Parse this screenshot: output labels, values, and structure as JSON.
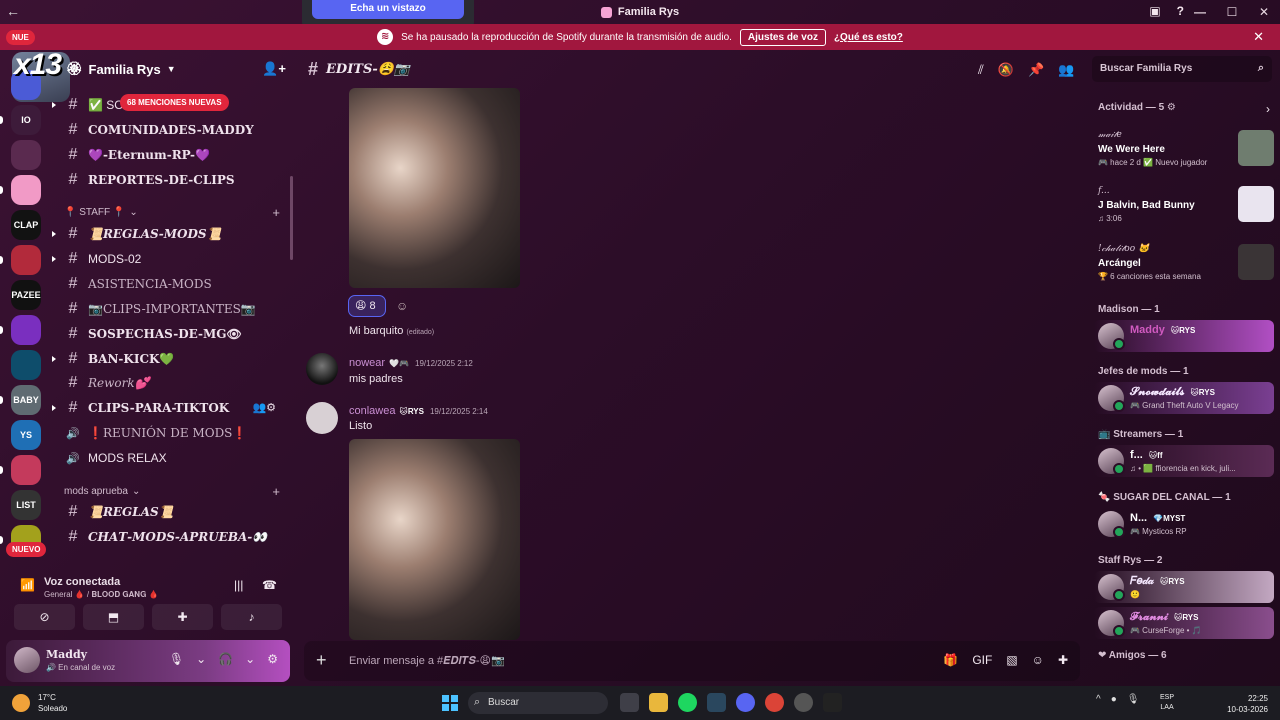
{
  "window": {
    "title": "Familia Rys",
    "peek_button": "Echa un vistazo"
  },
  "notice": {
    "text": "Se ha pausado la reproducción de Spotify durante la transmisión de audio.",
    "button": "Ajustes de voz",
    "link": "¿Qué es esto?"
  },
  "rail": {
    "top_badge": "NUE",
    "overlay_text": "x13",
    "io_label": "IO",
    "servers": [
      {
        "label": "",
        "badge": "",
        "color": "#4b5bd6"
      },
      {
        "label": "IO",
        "badge": "",
        "color": "#3d1b3a"
      },
      {
        "label": "",
        "badge": "",
        "color": "#5a2a4f"
      },
      {
        "label": "",
        "badge": "68",
        "color": "#f19ac6"
      },
      {
        "label": "CLAP",
        "badge": "43",
        "color": "#121212"
      },
      {
        "label": "",
        "badge": "10",
        "color": "#b22a3b"
      },
      {
        "label": "PAZEE",
        "badge": "2",
        "color": "#111"
      },
      {
        "label": "",
        "badge": "",
        "color": "#7a2fbf"
      },
      {
        "label": "",
        "badge": "6",
        "color": "#0e4d6b"
      },
      {
        "label": "BABY",
        "badge": "",
        "color": "#5f6b72"
      },
      {
        "label": "YS",
        "badge": "",
        "color": "#1f6fb5"
      },
      {
        "label": "",
        "badge": "77",
        "color": "#c43a5c"
      },
      {
        "label": "LIST",
        "badge": "5",
        "color": "#333"
      },
      {
        "label": "",
        "badge": "",
        "color": "#a3a11c"
      }
    ],
    "nuevo": "NUEVO"
  },
  "server": {
    "name": "Familia Rys",
    "mentions_pill": "68 MENCIONES NUEVAS"
  },
  "channels": [
    {
      "label": "✅ SOL",
      "style": "bold",
      "bullet": true
    },
    {
      "label": "COMUNIDADES-MADDY",
      "style": "serif"
    },
    {
      "label": "💜-Eternum-RP-💜",
      "style": "serif"
    },
    {
      "label": "REPORTES-DE-CLIPS",
      "style": "serif"
    }
  ],
  "categories": {
    "staff": "📍 STAFF 📍",
    "mods": "mods aprueba"
  },
  "staff_channels": [
    {
      "label": "📜𝑹𝑬𝑮𝑳𝑨𝑺-𝑴𝑶𝑫𝑺📜",
      "style": "serif italic",
      "bullet": true
    },
    {
      "label": "MODS-02",
      "style": "plain",
      "bullet": true
    },
    {
      "label": "ASISTENCIA-MODS",
      "style": "serif dim"
    },
    {
      "label": "📷CLIPS-IMPORTANTES📷",
      "style": "serif dim"
    },
    {
      "label": "SOSPECHAS-DE-MG👁",
      "style": "serif"
    },
    {
      "label": "BAN-KICK💚",
      "style": "serif",
      "bullet": true
    },
    {
      "label": "𝑅𝑒𝑤𝑜𝑟𝑘💕",
      "style": "serif italic dim"
    },
    {
      "label": "CLIPS-PARA-TIKTOK",
      "style": "serif",
      "bullet": true,
      "icons": "👥⚙"
    },
    {
      "label": "❗REUNIÓN DE MODS❗",
      "style": "serif dim",
      "voice": true
    },
    {
      "label": "MODS RELAX",
      "style": "plain",
      "voice": true
    }
  ],
  "mods_channels": [
    {
      "label": "📜𝑹𝑬𝑮𝑳𝑨𝑺📜",
      "style": "serif italic"
    },
    {
      "label": "𝑪𝑯𝑨𝑻-𝑴𝑶𝑫𝑺-𝑨𝑷𝑹𝑼𝑬𝑩𝑨-👀",
      "style": "serif italic"
    }
  ],
  "voice": {
    "title": "Voz conectada",
    "subtitle": "General 🩸 / 𝐁𝐋𝐎𝐎𝐃 𝐆𝐀𝐍𝐆 🩸"
  },
  "user": {
    "name": "Maddy",
    "status": "🔊 En canal de voz"
  },
  "channel_header": {
    "title": "𝑬𝑫𝑰𝑻𝑺-😩📷"
  },
  "search": {
    "placeholder": "Buscar Familia Rys"
  },
  "messages": {
    "reaction_count": "8",
    "caption": "Mi barquito",
    "edited": "(editado)",
    "m1": {
      "name": "nowear",
      "tag": "🤍🎮",
      "time": "19/12/2025 2:12",
      "text": "mis padres"
    },
    "m2": {
      "name": "conlawea",
      "tag": "🐱RYS",
      "time": "19/12/2025 2:14",
      "text": "Listo"
    }
  },
  "composer": {
    "placeholder": "Enviar mensaje a #𝑬𝑫𝑰𝑻𝑺-😩📷"
  },
  "members": {
    "activity_header": "Actividad — 5 ⚙",
    "activities": [
      {
        "name": "𝓂𝒶𝒾𝓉𝑒",
        "title": "We Were Here",
        "sub": "🎮 hace 2 d  ✅ Nuevo jugador",
        "thumb": "#6f7d6f"
      },
      {
        "name": "f...",
        "title": "J Balvin, Bad Bunny",
        "sub": "♫ 3:06",
        "thumb": "#e9e4ef"
      },
      {
        "name": "!𝒸𝒽𝒶𝓁𝒾𝓉𝑜𝑜 🐱",
        "title": "Arcángel",
        "sub": "🏆 6 canciones esta semana",
        "thumb": "#3a3436"
      }
    ],
    "groups": [
      {
        "header": "Madison — 1",
        "name": "Maddy",
        "tag": "🐱RYS",
        "status": "",
        "bg": "linear-gradient(90deg,rgba(0,0,0,0),#b14fc4)",
        "name_color": "#d05ac0"
      },
      {
        "header": "Jefes de mods — 1",
        "name": "𝓢𝓷𝓸𝔀𝓭𝓪𝓲𝓵𝓼",
        "tag": "🐱RYS",
        "status": "🎮 Grand Theft Auto V Legacy",
        "bg": "linear-gradient(90deg,rgba(0,0,0,0),#7a3f92)",
        "name_color": "#f5e8ff"
      },
      {
        "header": "📺 Streamers — 1",
        "name": "f...",
        "tag": "🐱ff",
        "status": "♫ • 🟩 ffiorencia en kick, juli...",
        "bg": "linear-gradient(90deg,rgba(0,0,0,0),#5b2b55)",
        "name_color": "#fff"
      },
      {
        "header": "🍬 SUGAR DEL CANAL — 1",
        "name": "N...",
        "tag": "💎MYST",
        "status": "🎮 Mysticos RP",
        "bg": "none",
        "name_color": "#fff"
      },
      {
        "header": "Staff Rys — 2",
        "name": "𝐹𝑒𝒹𝒶",
        "tag": "🐱RYS",
        "status": "🙂",
        "bg": "linear-gradient(90deg,rgba(0,0,0,0),#c3a8c2)",
        "name_color": "#f5e8ff"
      },
      {
        "header": "",
        "name": "𝓕𝓻𝓪𝓷𝓷𝓲",
        "tag": "🐱RYS",
        "status": "🎮 CurseForge • 🎵",
        "bg": "linear-gradient(90deg,rgba(0,0,0,0),#8a4e8d)",
        "name_color": "#e08be0"
      },
      {
        "header": "❤ Amigos — 6",
        "name": "",
        "tag": "",
        "status": "",
        "bg": "none",
        "name_color": "#fff"
      }
    ]
  },
  "taskbar": {
    "temp": "17°C",
    "weather": "Soleado",
    "search": "Buscar",
    "lang1": "ESP",
    "lang2": "LAA",
    "time": "22:25",
    "date": "10-03-2026"
  }
}
